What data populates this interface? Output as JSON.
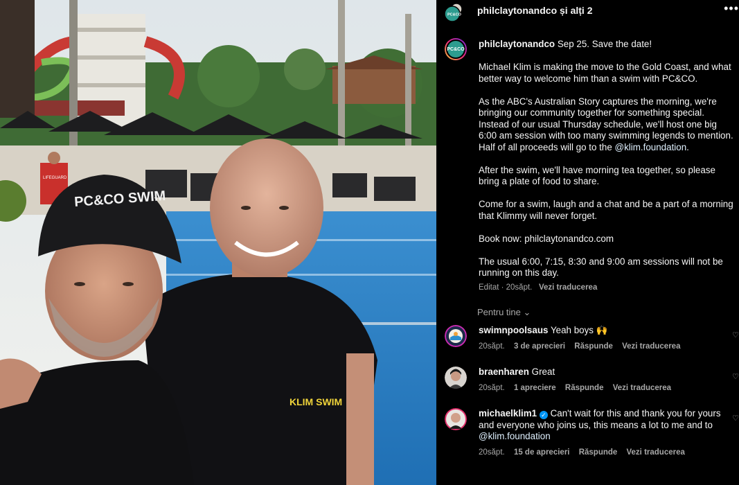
{
  "header": {
    "title": "philclaytonandco și alți 2",
    "more_icon": "•••"
  },
  "post": {
    "avatar_text": "PC&CO",
    "username": "philclaytonandco",
    "caption_first": "Sep 25. Save the date!",
    "para1": "Michael Klim is making the move to the Gold Coast, and what better way to welcome him than a swim with PC&CO.",
    "para2a": "As the ABC's Australian Story captures the morning, we're bringing our community together for something special. Instead of our usual Thursday schedule, we'll host one big 6:00 am session with too many swimming legends to mention. Half of all proceeds will go to the ",
    "para2_link": "@klim.foundation",
    "para2b": ".",
    "para3": "After the swim, we'll have morning tea together, so please bring a plate of food to share.",
    "para4": "Come for a swim, laugh and a chat and be a part of a morning that Klimmy will never forget.",
    "para5": "Book now: philclaytonandco.com",
    "para6": "The usual 6:00, 7:15, 8:30 and 9:00 am sessions will not be running on this day.",
    "meta_edited": "Editat · 20săpt.",
    "meta_translate": "Vezi traducerea"
  },
  "photo": {
    "cap_text": "PC&CO SWIM",
    "shirt_text": "KLIM SWIM",
    "lifeguard_text": "LIFEGUARD"
  },
  "for_you": "Pentru tine",
  "comments": [
    {
      "user": "swimnpoolsaus",
      "text": "Yeah boys 🙌",
      "time": "20săpt.",
      "likes": "3 de aprecieri",
      "reply": "Răspunde",
      "translate": "Vezi traducerea"
    },
    {
      "user": "braenharen",
      "text": "Great",
      "time": "20săpt.",
      "likes": "1 apreciere",
      "reply": "Răspunde",
      "translate": "Vezi traducerea"
    },
    {
      "user": "michaelklim1",
      "text": "Can't wait for this and thank you for yours and everyone who joins us, this means a lot to me and to ",
      "link": "@klim.foundation",
      "time": "20săpt.",
      "likes": "15 de aprecieri",
      "reply": "Răspunde",
      "translate": "Vezi traducerea"
    }
  ],
  "colors": {
    "background": "#000000",
    "text": "#f5f5f5",
    "secondary": "#a8a8a8",
    "link": "#e0f1ff",
    "verified": "#0095f6",
    "brand_teal": "#2d9c8f"
  }
}
